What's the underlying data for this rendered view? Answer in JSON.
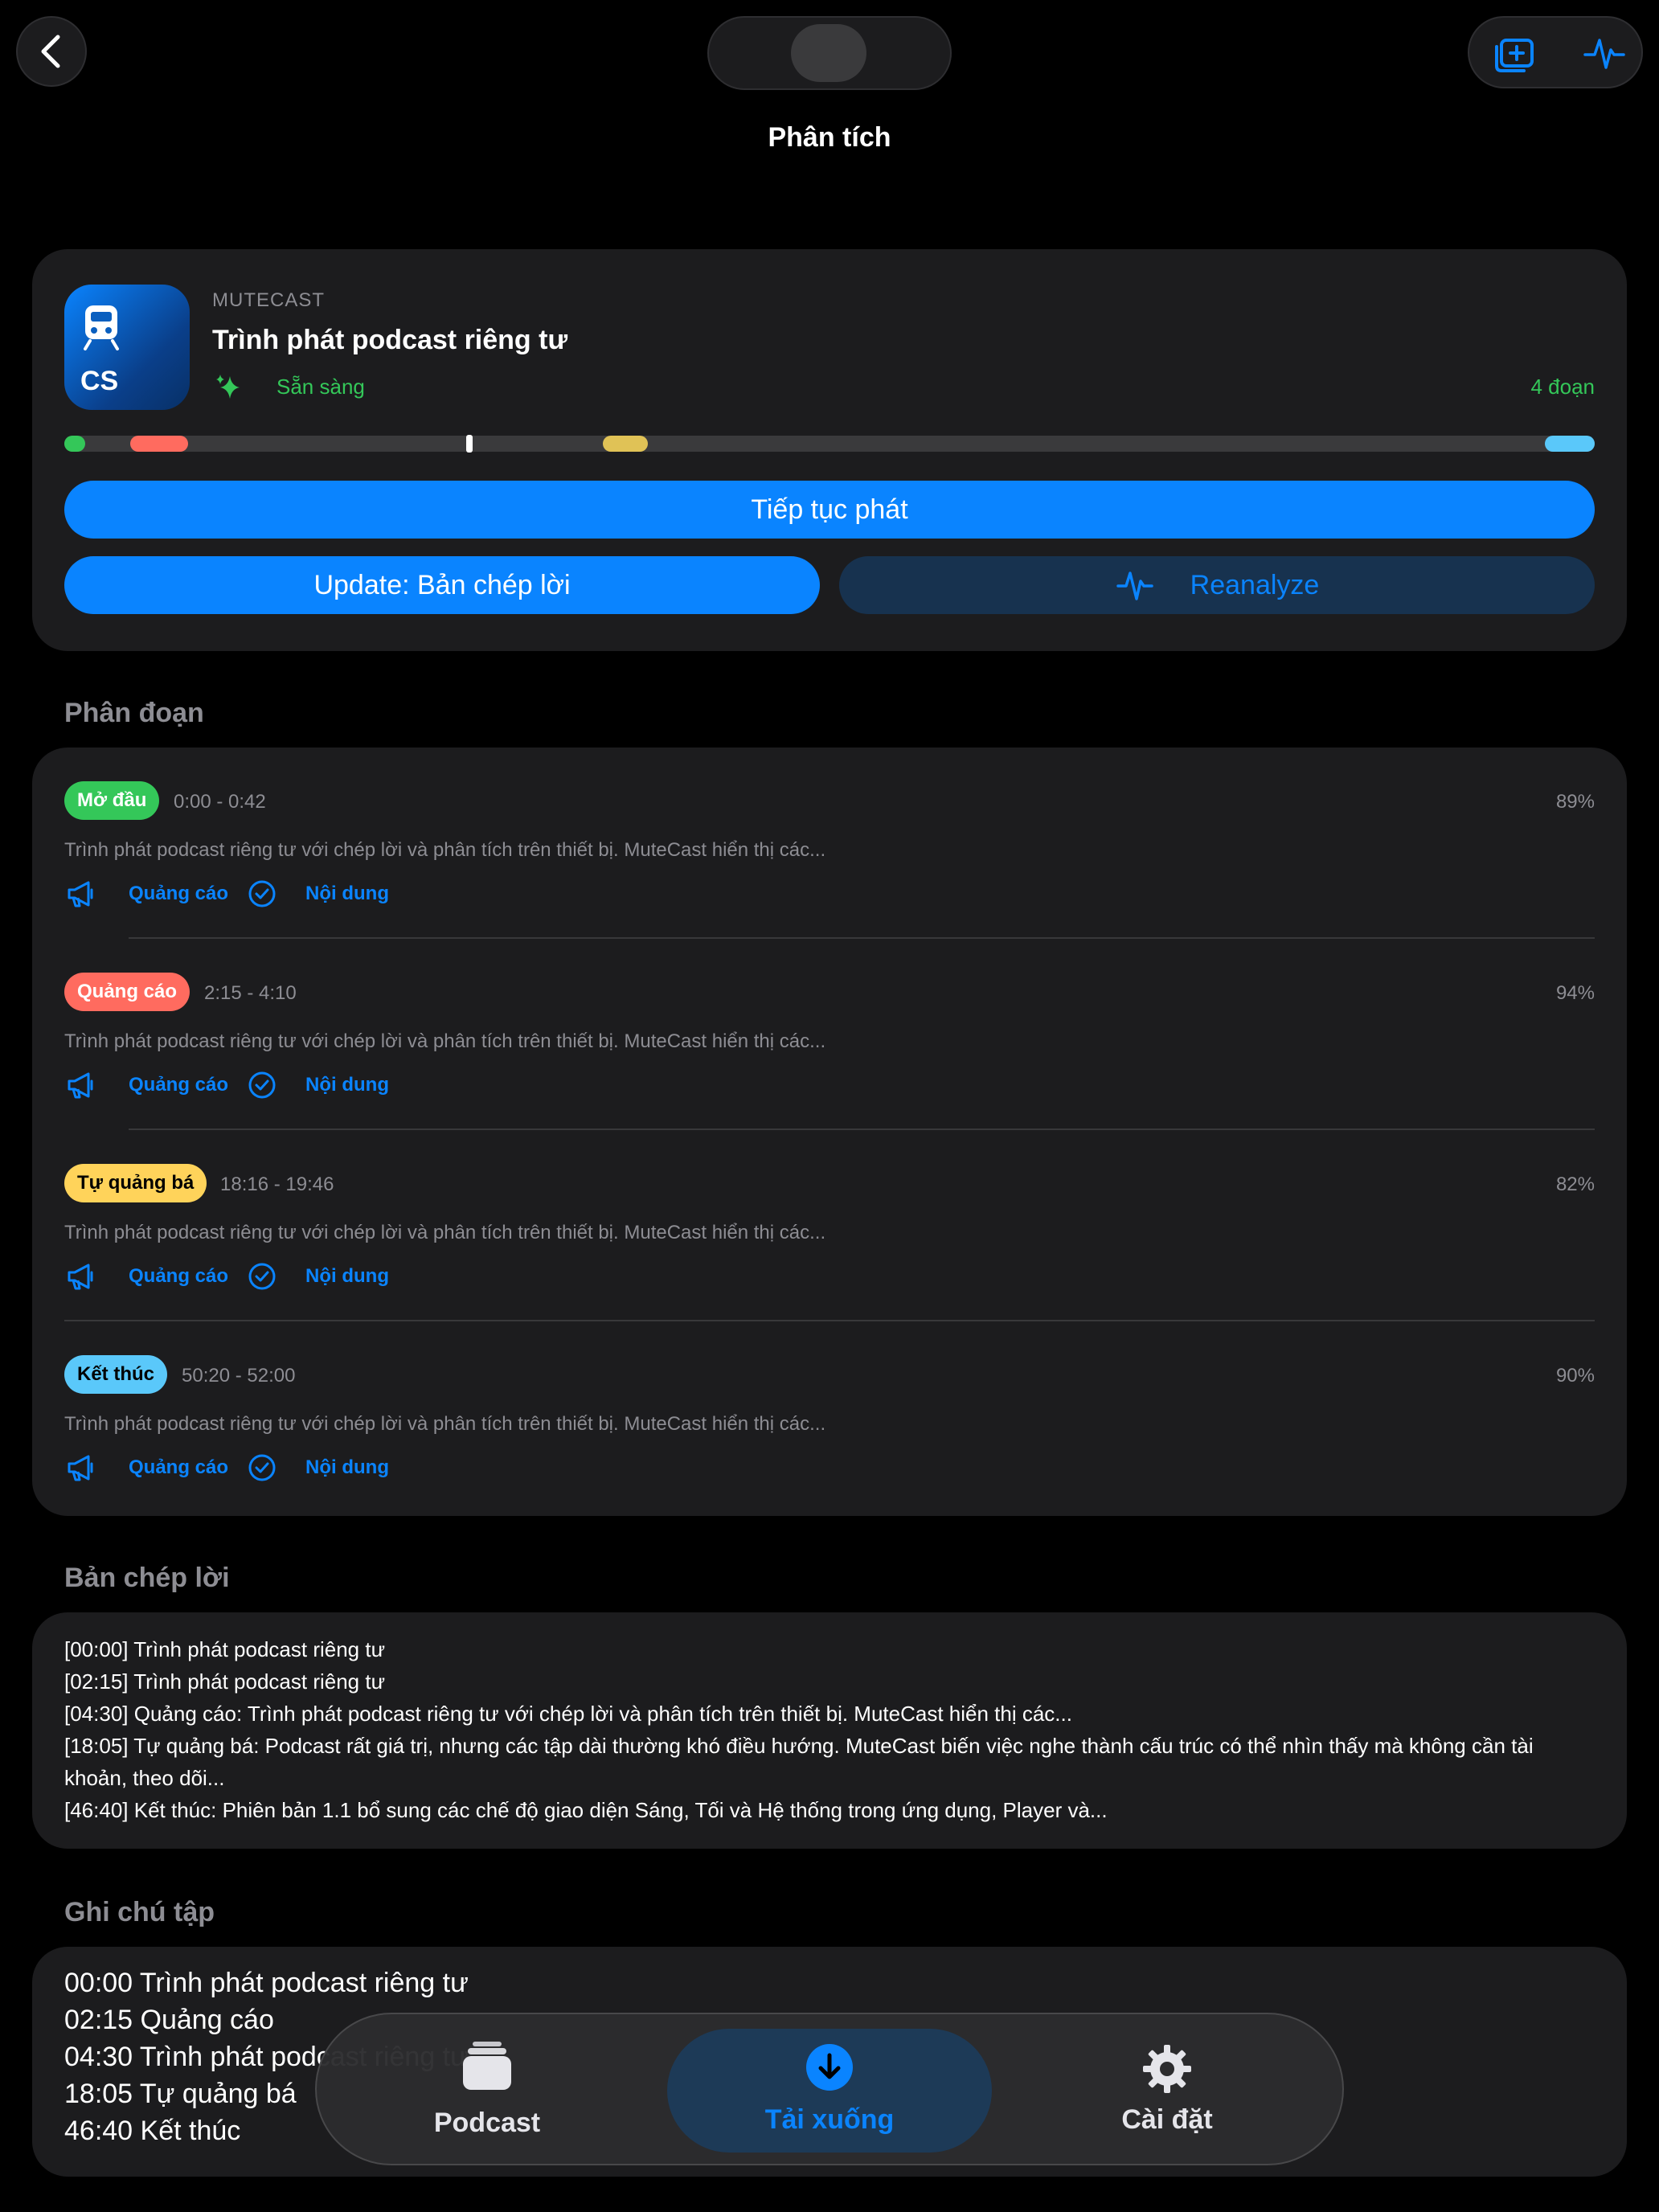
{
  "nav": {
    "title": "Phân tích",
    "icons": [
      "chevron-left-icon",
      "add-to-queue-icon",
      "waveform-icon"
    ]
  },
  "header": {
    "brand": "MUTECAST",
    "app_icon_text": "CS",
    "episode_title": "Trình phát podcast riêng tư",
    "status": "Sẵn sàng",
    "segment_count": "4 đoạn",
    "primary_button": "Tiếp tục phát",
    "update_button": "Update: Bản chép lời",
    "reanalyze_button": "Reanalyze",
    "colors": {
      "accent": "#0a84ff",
      "ready": "#34c759"
    }
  },
  "segments_section": {
    "title": "Phân đoạn",
    "ad_label": "Quảng cáo",
    "content_label": "Nội dung",
    "items": [
      {
        "label": "Mở đầu",
        "time": "0:00 - 0:42",
        "confidence": "89%",
        "color": "#34c759",
        "text_color": "#ffffff",
        "description": "Trình phát podcast riêng tư với chép lời và phân tích trên thiết bị. MuteCast hiển thị các..."
      },
      {
        "label": "Quảng cáo",
        "time": "2:15 - 4:10",
        "confidence": "94%",
        "color": "#ff6b5f",
        "text_color": "#ffffff",
        "description": "Trình phát podcast riêng tư với chép lời và phân tích trên thiết bị. MuteCast hiển thị các..."
      },
      {
        "label": "Tự quảng bá",
        "time": "18:16 - 19:46",
        "confidence": "82%",
        "color": "#ffd35a",
        "text_color": "#000000",
        "description": "Trình phát podcast riêng tư với chép lời và phân tích trên thiết bị. MuteCast hiển thị các..."
      },
      {
        "label": "Kết thúc",
        "time": "50:20 - 52:00",
        "confidence": "90%",
        "color": "#5ac8fa",
        "text_color": "#000000",
        "description": "Trình phát podcast riêng tư với chép lời và phân tích trên thiết bị. MuteCast hiển thị các..."
      }
    ]
  },
  "transcript": {
    "title": "Bản chép lời",
    "lines": [
      "[00:00] Trình phát podcast riêng tư",
      "[02:15] Trình phát podcast riêng tư",
      "[04:30] Quảng cáo: Trình phát podcast riêng tư với chép lời và phân tích trên thiết bị. MuteCast hiển thị các...",
      "[18:05] Tự quảng bá: Podcast rất giá trị, nhưng các tập dài thường khó điều hướng. MuteCast biến việc nghe thành cấu trúc có thể nhìn thấy mà không cần tài khoản, theo dõi...",
      "[46:40] Kết thúc: Phiên bản 1.1 bổ sung các chế độ giao diện Sáng, Tối và Hệ thống trong ứng dụng, Player và..."
    ]
  },
  "notes": {
    "title": "Ghi chú tập",
    "lines": [
      "00:00 Trình phát podcast riêng tư",
      "02:15 Quảng cáo",
      "04:30 Trình phát podcast riêng tư",
      "18:05 Tự quảng bá",
      "46:40 Kết thúc"
    ]
  },
  "tabbar": {
    "selected": "downloads",
    "tabs": [
      {
        "id": "podcasts",
        "label": "Podcast",
        "icon": "stack-icon"
      },
      {
        "id": "downloads",
        "label": "Tải xuống",
        "icon": "download-circle-icon"
      },
      {
        "id": "settings",
        "label": "Cài đặt",
        "icon": "gear-icon"
      }
    ]
  }
}
